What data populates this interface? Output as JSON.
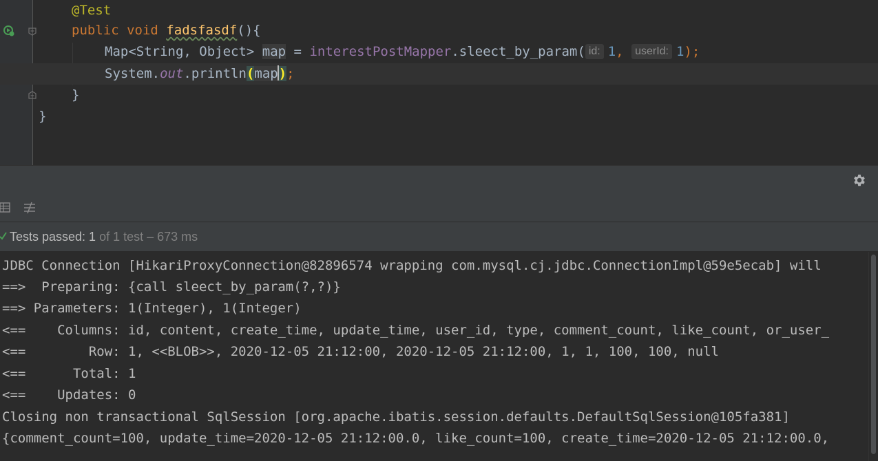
{
  "editor": {
    "annotation": "@Test",
    "method_kw_public": "public",
    "method_kw_void": "void",
    "method_name": "fadsfasdf",
    "method_tail": "(){",
    "line3": {
      "type_prefix": "Map<String, Object> ",
      "var": "map",
      "assign": " = ",
      "mapper": "interestPostMapper",
      "call": ".sleect_by_param(",
      "hint1": "id:",
      "arg1": "1",
      "comma": ", ",
      "hint2": "userId:",
      "arg2": "1",
      "close": ");"
    },
    "line4": {
      "prefix": "System.",
      "out": "out",
      "println": ".println",
      "open_paren": "(",
      "arg": "map",
      "close_paren": ")",
      "semi": ";"
    },
    "close_method": "}",
    "close_class": "}"
  },
  "test_status": {
    "passed_label": "Tests passed: 1",
    "detail": " of 1 test – 673 ms"
  },
  "console_lines": [
    "JDBC Connection [HikariProxyConnection@82896574 wrapping com.mysql.cj.jdbc.ConnectionImpl@59e5ecab] will",
    "==>  Preparing: {call sleect_by_param(?,?)}",
    "==> Parameters: 1(Integer), 1(Integer)",
    "<==    Columns: id, content, create_time, update_time, user_id, type, comment_count, like_count, or_user_",
    "<==        Row: 1, <<BLOB>>, 2020-12-05 21:12:00, 2020-12-05 21:12:00, 1, 1, 100, 100, null",
    "<==      Total: 1",
    "<==    Updates: 0",
    "Closing non transactional SqlSession [org.apache.ibatis.session.defaults.DefaultSqlSession@105fa381]",
    "{comment_count=100, update_time=2020-12-05 21:12:00.0, like_count=100, create_time=2020-12-05 21:12:00.0,"
  ],
  "icons": {
    "run": "run-test-icon",
    "settings": "gear-icon",
    "table": "table-icon",
    "filter": "filter-icon",
    "passed": "check-icon"
  },
  "colors": {
    "background": "#2b2b2b",
    "keyword": "#cc7832",
    "method": "#ffc66d",
    "field": "#9876aa",
    "number": "#6897bb",
    "pass": "#499c54"
  }
}
